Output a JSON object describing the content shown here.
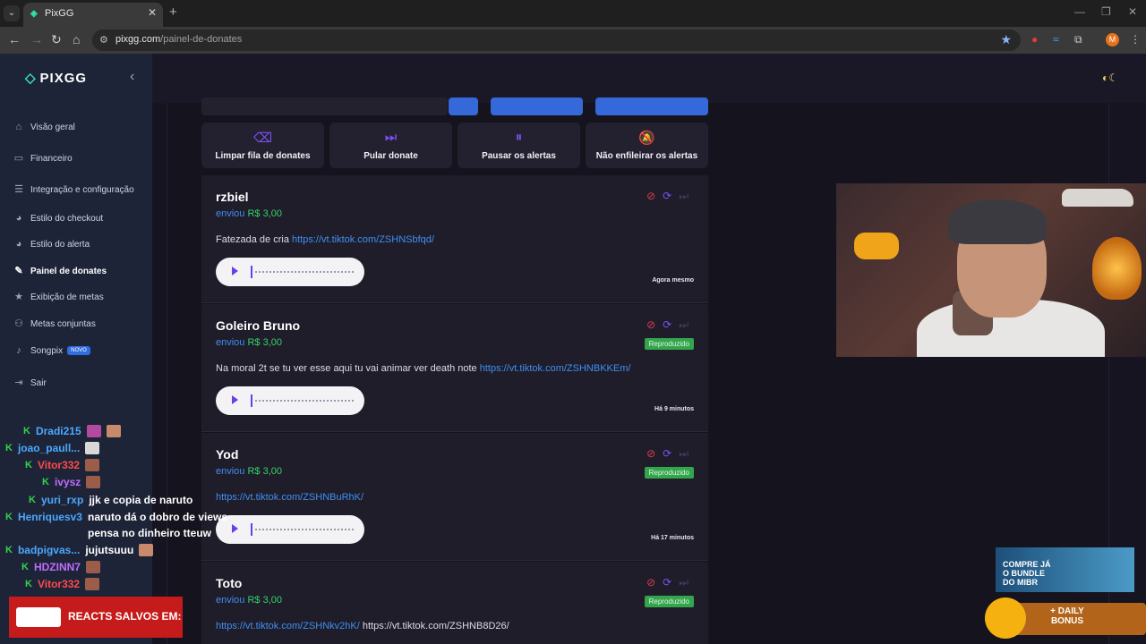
{
  "browser": {
    "tab_title": "PixGG",
    "url_host": "pixgg.com",
    "url_path": "/painel-de-donates",
    "profile_initial": "M"
  },
  "sidebar": {
    "logo": "PIXGG",
    "items": [
      {
        "label": "Visão geral",
        "icon": "home-icon"
      },
      {
        "label": "Financeiro",
        "icon": "card-icon"
      },
      {
        "label": "Integração e configuração",
        "icon": "settings-icon"
      },
      {
        "label": "Estilo do checkout",
        "icon": "palette-icon"
      },
      {
        "label": "Estilo do alerta",
        "icon": "palette-icon"
      },
      {
        "label": "Painel de donates",
        "icon": "donate-icon"
      },
      {
        "label": "Exibição de metas",
        "icon": "star-icon"
      },
      {
        "label": "Metas conjuntas",
        "icon": "users-icon"
      },
      {
        "label": "Songpix",
        "icon": "music-icon",
        "badge": "NOVO"
      },
      {
        "label": "Sair",
        "icon": "logout-icon"
      }
    ]
  },
  "actions": [
    {
      "label": "Limpar fila de donates",
      "icon": "eraser-icon"
    },
    {
      "label": "Pular donate",
      "icon": "skip-icon"
    },
    {
      "label": "Pausar os alertas",
      "icon": "pause-icon"
    },
    {
      "label": "Não enfileirar os alertas",
      "icon": "bell-off-icon"
    }
  ],
  "donations": [
    {
      "name": "rzbiel",
      "sent_label": "enviou",
      "amount": "R$ 3,00",
      "message": "Fatezada de cria",
      "link": "https://vt.tiktok.com/ZSHNSbfqd/",
      "time": "Agora mesmo",
      "status": ""
    },
    {
      "name": "Goleiro Bruno",
      "sent_label": "enviou",
      "amount": "R$ 3,00",
      "message": "Na moral 2t se tu ver esse aqui tu vai animar ver death note",
      "link": "https://vt.tiktok.com/ZSHNBKKEm/",
      "time": "Há 9 minutos",
      "status": "Reproduzido"
    },
    {
      "name": "Yod",
      "sent_label": "enviou",
      "amount": "R$ 3,00",
      "message": "",
      "link": "https://vt.tiktok.com/ZSHNBuRhK/",
      "time": "Há 17 minutos",
      "status": "Reproduzido"
    },
    {
      "name": "Toto",
      "sent_label": "enviou",
      "amount": "R$ 3,00",
      "message": "",
      "link": "https://vt.tiktok.com/ZSHNkv2hK/",
      "extra": "https://vt.tiktok.com/ZSHNB8D26/",
      "time": "",
      "status": "Reproduzido"
    }
  ],
  "chat": [
    {
      "user": "Dradi215",
      "color": "#4aa8ff",
      "text": ""
    },
    {
      "user": "joao_paull...",
      "color": "#4aa8ff",
      "text": ""
    },
    {
      "user": "Vitor332",
      "color": "#ff4a4a",
      "text": ""
    },
    {
      "user": "ivysz",
      "color": "#c06cff",
      "text": ""
    },
    {
      "user": "yuri_rxp",
      "color": "#4aa8ff",
      "text": "jjk e copia de naruto"
    },
    {
      "user": "Henriquesv3",
      "color": "#4aa8ff",
      "text": "naruto dá o dobro de views"
    },
    {
      "user": "",
      "color": "#ffffff",
      "text": "pensa no dinheiro tteuw"
    },
    {
      "user": "badpigvas...",
      "color": "#4aa8ff",
      "text": "jujutsuuu"
    },
    {
      "user": "HDZINN7",
      "color": "#c06cff",
      "text": ""
    },
    {
      "user": "Vitor332",
      "color": "#ff4a4a",
      "text": ""
    }
  ],
  "overlay": {
    "react_banner": "REACTS SALVOS EM:",
    "promo": "COMPRE JÁ O BUNDLE DO MIBR",
    "daily": "+ DAILY BONUS"
  },
  "colors": {
    "accent": "#7d4ff5",
    "link": "#3f8ff0",
    "amount": "#34d36a",
    "status_ok": "#33a54b"
  }
}
